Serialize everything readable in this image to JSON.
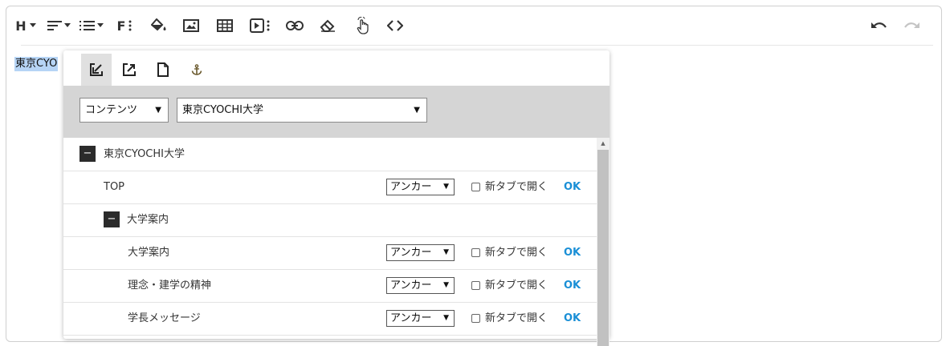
{
  "editor": {
    "selected_text": "東京CYO"
  },
  "toolbar": {
    "heading_label": "H",
    "font_label": "F",
    "icons": [
      "heading-icon",
      "align-icon",
      "list-icon",
      "font-icon",
      "fill-color-icon",
      "image-icon",
      "table-icon",
      "media-icon",
      "link-icon",
      "eraser-icon",
      "hand-pointer-icon",
      "code-icon",
      "undo-icon",
      "redo-icon"
    ]
  },
  "popup": {
    "tabs": [
      {
        "name": "internal-link-tab",
        "icon": "arrow-down-left-icon",
        "active": true
      },
      {
        "name": "external-link-tab",
        "icon": "external-link-icon",
        "active": false
      },
      {
        "name": "file-link-tab",
        "icon": "file-icon",
        "active": false
      },
      {
        "name": "anchor-link-tab",
        "icon": "anchor-icon",
        "active": false
      }
    ],
    "content_type_select": "コンテンツ",
    "site_select": "東京CYOCHI大学",
    "toggle_symbol": "−",
    "caret": "▼",
    "scroll_up": "▲",
    "tree": [
      {
        "label": "東京CYOCHI大学",
        "level": 0,
        "type": "parent"
      },
      {
        "label": "TOP",
        "level": 1,
        "type": "item",
        "anchor": "アンカー",
        "new_tab": "新タブで開く",
        "ok": "OK"
      },
      {
        "label": "大学案内",
        "level": 1,
        "type": "parent"
      },
      {
        "label": "大学案内",
        "level": 2,
        "type": "item",
        "anchor": "アンカー",
        "new_tab": "新タブで開く",
        "ok": "OK"
      },
      {
        "label": "理念・建学の精神",
        "level": 2,
        "type": "item",
        "anchor": "アンカー",
        "new_tab": "新タブで開く",
        "ok": "OK"
      },
      {
        "label": "学長メッセージ",
        "level": 2,
        "type": "item",
        "anchor": "アンカー",
        "new_tab": "新タブで開く",
        "ok": "OK"
      }
    ]
  }
}
